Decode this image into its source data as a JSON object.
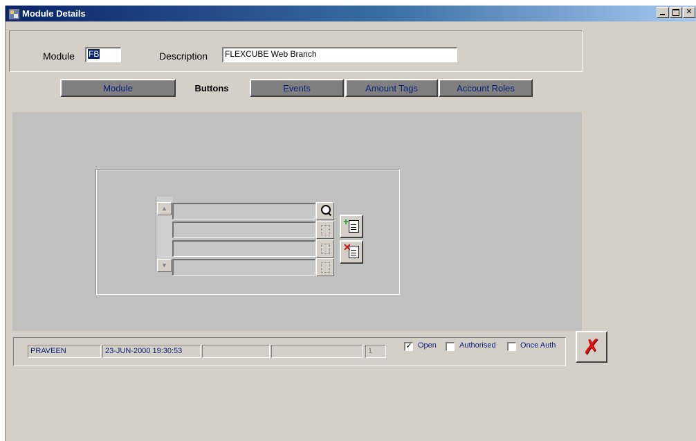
{
  "window": {
    "title": "Module Details",
    "controls": {
      "minimize": "minimize-icon",
      "maximize": "maximize-icon",
      "close": "close-icon"
    }
  },
  "header": {
    "module_label": "Module",
    "module_value": "FB",
    "description_label": "Description",
    "description_value": "FLEXCUBE Web Branch"
  },
  "tabs": [
    {
      "label": "Module",
      "active": false
    },
    {
      "label": "Buttons",
      "active": true
    },
    {
      "label": "Events",
      "active": false
    },
    {
      "label": "Amount Tags",
      "active": false
    },
    {
      "label": "Account Roles",
      "active": false
    }
  ],
  "grid": {
    "rows": [
      "",
      "",
      "",
      ""
    ]
  },
  "status": {
    "maker": "PRAVEEN",
    "maker_timestamp": "23-JUN-2000 19:30:53",
    "checker": "",
    "checker_timestamp": "",
    "modification_no": "1",
    "open_label": "Open",
    "open_checked": true,
    "authorised_label": "Authorised",
    "authorised_checked": false,
    "once_auth_label": "Once Auth",
    "once_auth_checked": false
  },
  "colors": {
    "title_start": "#0a246a",
    "exit_icon": "#e01010",
    "label_blue": "#0a1e78"
  }
}
